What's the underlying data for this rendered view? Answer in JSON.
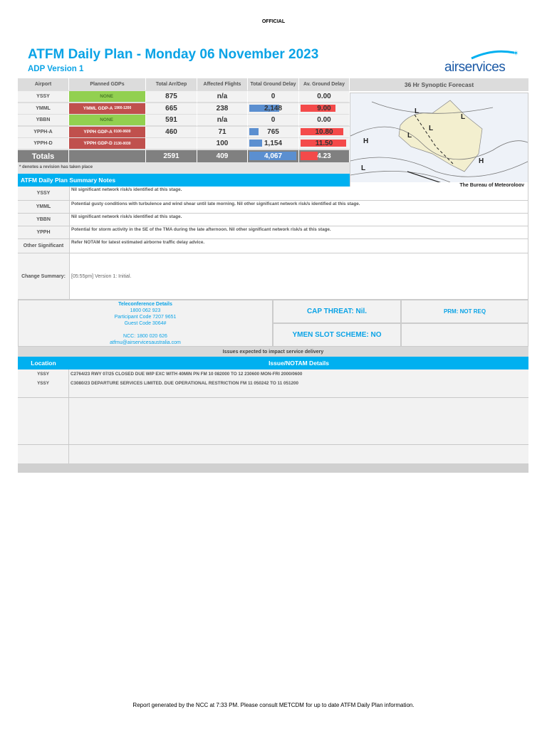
{
  "official": "OFFICIAL",
  "title": "ATFM Daily Plan - Monday 06 November 2023",
  "version": "ADP Version 1",
  "logo": "airservices",
  "table": {
    "headers": [
      "Airport",
      "Planned GDPs",
      "Total Arr/Dep",
      "Affected Flights",
      "Total Ground Delay",
      "Av. Ground Delay"
    ],
    "rows": [
      {
        "airport": "YSSY",
        "gdp": "NONE",
        "gdp_main": "NONE",
        "gdp_time": "",
        "arrdep": "875",
        "affected": "n/a",
        "tgd": "0",
        "agd": "0.00",
        "tgd_frac": 0,
        "agd_frac": 0
      },
      {
        "airport": "YMML",
        "gdp_main": "YMML GDP-A",
        "gdp_time": "1900-1200",
        "arrdep": "665",
        "affected": "238",
        "tgd": "2,148",
        "agd": "9.00",
        "tgd_frac": 0.63,
        "agd_frac": 0.77
      },
      {
        "airport": "YBBN",
        "gdp_main": "NONE",
        "gdp_time": "",
        "arrdep": "591",
        "affected": "n/a",
        "tgd": "0",
        "agd": "0.00",
        "tgd_frac": 0,
        "agd_frac": 0
      },
      {
        "airport": "YPPH-A",
        "gdp_main": "YPPH GDP-A",
        "gdp_time": "0100-0600",
        "arrdep": "460",
        "affected": "71",
        "tgd": "765",
        "agd": "10.80",
        "tgd_frac": 0.2,
        "agd_frac": 0.93
      },
      {
        "airport": "YPPH-D",
        "gdp_main": "YPPH GDP-D",
        "gdp_time": "2130-0030",
        "arrdep": "",
        "affected": "100",
        "tgd": "1,154",
        "agd": "11.50",
        "tgd_frac": 0.27,
        "agd_frac": 1.0
      }
    ],
    "totals": {
      "label": "Totals",
      "arrdep": "2591",
      "affected": "409",
      "tgd": "4,067",
      "agd": "4.23",
      "tgd_frac": 1.0,
      "agd_frac": 0.37
    },
    "note": "* denotes a revision has taken place"
  },
  "synoptic": {
    "title": "36 Hr Synoptic Forecast",
    "credit": "The Bureau of Meteorology"
  },
  "summary": {
    "header": "ATFM Daily Plan Summary Notes",
    "rows": [
      {
        "label": "YSSY",
        "text": "Nil significant network risk/s identified at this stage."
      },
      {
        "label": "YMML",
        "text": "Potential gusty conditions with turbulence and wind shear until late morning. Nil other significant network risk/s identified at this stage."
      },
      {
        "label": "YBBN",
        "text": "Nil significant network risk/s identified at this stage."
      },
      {
        "label": "YPPH",
        "text": "Potential for storm activity in the SE of the TMA during the late afternoon. Nil other significant network risk/s at this stage."
      },
      {
        "label": "Other Significant",
        "text": "Refer NOTAM for latest estimated airborne traffic delay advice."
      }
    ],
    "change_label": "Change Summary:",
    "change_text": "[05:55pm] Version 1: Initial."
  },
  "teleconference": {
    "title": "Teleconference Details",
    "phone": "1800 062 923",
    "participant": "Participant Code 7207 9651",
    "guest": "Guest Code 3064#",
    "ncc": "NCC: 1800 020 626",
    "email": "atfmu@airservicesaustralia.com"
  },
  "cap_threat": "CAP THREAT: Nil.",
  "prm": "PRM: NOT REQ",
  "slot_scheme": "YMEN SLOT SCHEME: NO",
  "issues": {
    "title": "Issues expected to impact service delivery",
    "col_location": "Location",
    "col_details": "Issue/NOTAM Details",
    "rows": [
      {
        "location": "YSSY",
        "details": "C2764/23 RWY 07/25 CLOSED DUE WIP EXC WITH 40MIN PN FM 10 082000 TO 12 230600 MON-FRI 2000/0600"
      },
      {
        "location": "YSSY",
        "details": "C3080/23 DEPARTURE SERVICES LIMITED. DUE OPERATIONAL RESTRICTION FM 11 050242 TO 11 051200"
      }
    ]
  },
  "footer": "Report generated by the NCC at 7:33 PM. Please consult METCDM for up to date ATFM Daily Plan information.",
  "colors": {
    "accent": "#0aa3e6",
    "header_blue": "#00b0f0",
    "green": "#92d050",
    "red": "#c0504d",
    "bar_blue": "#5b8fd0",
    "bar_red": "#f44a4a"
  }
}
